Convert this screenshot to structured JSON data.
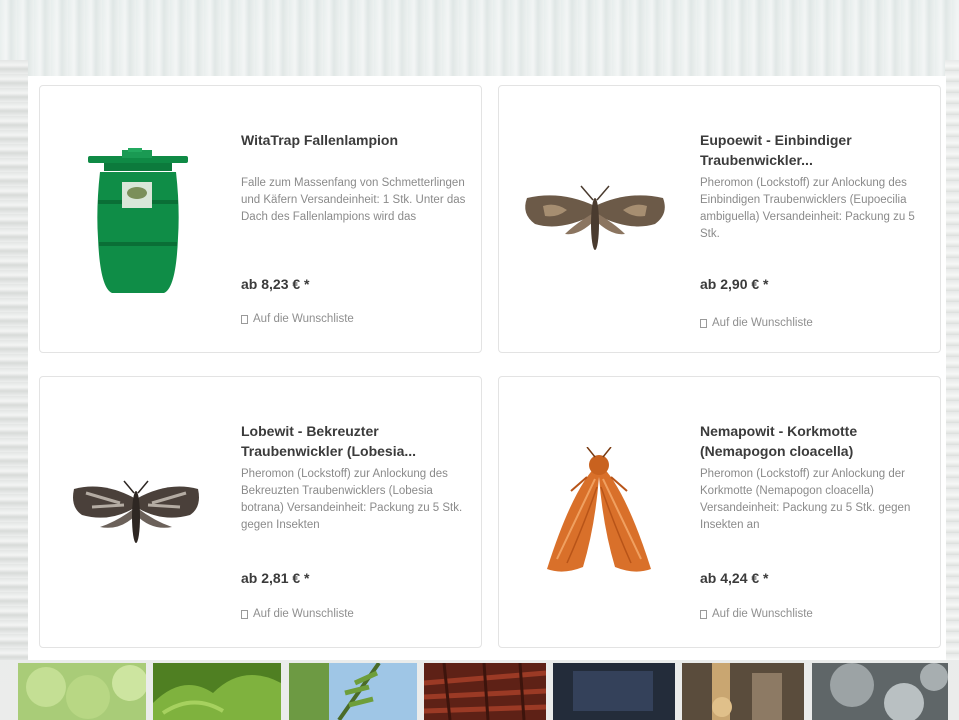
{
  "products": [
    {
      "title": "WitaTrap Fallenlampion",
      "description": "Falle zum Massenfang von Schmetterlingen und Käfern Versandeinheit: 1 Stk. Unter das Dach des Fallenlampions wird das",
      "price": "ab 8,23 € *",
      "wishlist_label": "Auf die Wunschliste",
      "image_icon": "green-trap-lantern"
    },
    {
      "title": "Eupoewit - Einbindiger Traubenwickler...",
      "description": "Pheromon (Lockstoff) zur Anlockung des Einbindigen Traubenwicklers (Eupoecilia ambiguella) Versandeinheit: Packung zu 5 Stk.",
      "price": "ab 2,90 € *",
      "wishlist_label": "Auf die Wunschliste",
      "image_icon": "brown-moth"
    },
    {
      "title": "Lobewit - Bekreuzter Traubenwickler (Lobesia...",
      "description": "Pheromon (Lockstoff) zur Anlockung des Bekreuzten Traubenwicklers (Lobesia botrana) Versandeinheit: Packung zu 5 Stk. gegen Insekten",
      "price": "ab 2,81 € *",
      "wishlist_label": "Auf die Wunschliste",
      "image_icon": "grey-moth"
    },
    {
      "title": "Nemapowit - Korkmotte (Nemapogon cloacella)",
      "description": "Pheromon (Lockstoff) zur Anlockung der Korkmotte (Nemapogon cloacella) Versandeinheit: Packung zu 5 Stk. gegen Insekten an",
      "price": "ab 4,24 € *",
      "wishlist_label": "Auf die Wunschliste",
      "image_icon": "orange-moth"
    }
  ],
  "thumbnails": [
    {
      "name": "green-grapes-thumbnail",
      "color": "#9fc36b"
    },
    {
      "name": "green-leaves-thumbnail",
      "color": "#5f8f2c"
    },
    {
      "name": "vine-sky-thumbnail",
      "color": "#7fae5a"
    },
    {
      "name": "red-wood-thumbnail",
      "color": "#7a2a1c"
    },
    {
      "name": "dark-blue-thumbnail",
      "color": "#2b3546"
    },
    {
      "name": "wood-structure-thumbnail",
      "color": "#6a5a48"
    },
    {
      "name": "grey-spheres-thumbnail",
      "color": "#8d9496"
    }
  ]
}
